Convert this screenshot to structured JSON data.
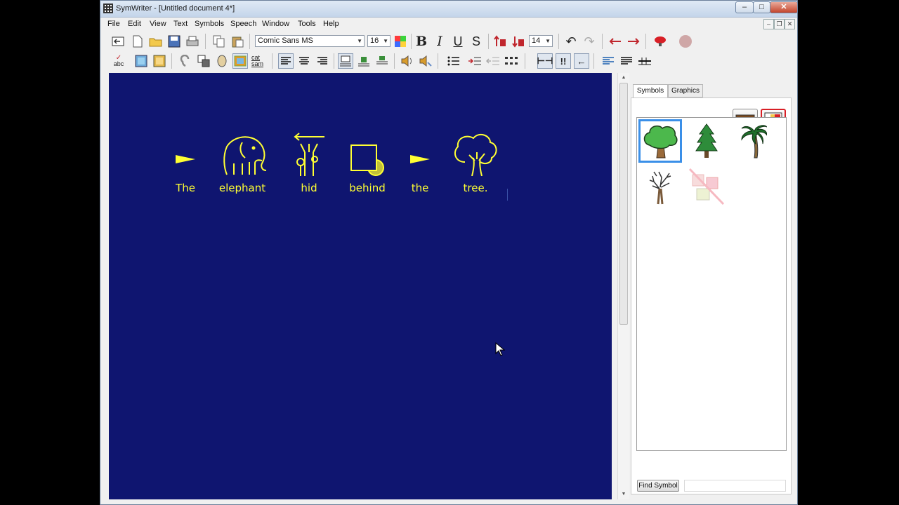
{
  "window": {
    "title": "SymWriter - [Untitled document 4*]",
    "min": "–",
    "max": "□",
    "close": "✕"
  },
  "menu": [
    "File",
    "Edit",
    "View",
    "Text",
    "Symbols",
    "Speech",
    "Window",
    "Tools",
    "Help"
  ],
  "toolbar1": {
    "font": "Comic Sans MS",
    "font_size": "16",
    "symbol_size": "14",
    "bold": "B",
    "italic": "I",
    "underline": "U",
    "strike": "S"
  },
  "toolbar2": {
    "spell": "abc",
    "cat_sam": "cat sam"
  },
  "document": {
    "background": "#0f1570",
    "text_color": "#ffff33",
    "words": [
      "The",
      "elephant",
      "hid",
      "behind",
      "the",
      "tree."
    ]
  },
  "panel": {
    "tabs": [
      "Symbols",
      "Graphics"
    ],
    "active_tab": "Symbols",
    "symbols": [
      "tree-deciduous",
      "tree-pine",
      "palm-tree",
      "bare-tree",
      "no-symbol"
    ],
    "find_label": "Find Symbol",
    "find_value": ""
  }
}
